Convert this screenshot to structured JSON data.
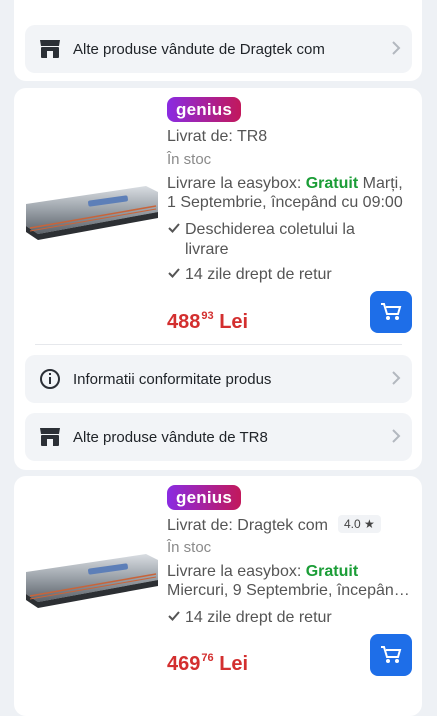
{
  "top_card": {
    "seller_row_label": "Alte produse vândute de Dragtek com"
  },
  "offers": [
    {
      "badge": "genius",
      "seller": "Livrat de: TR8",
      "rating": "",
      "stock": "În stoc",
      "delivery_prefix": "Livrare la easybox: ",
      "delivery_free": "Gratuit",
      "delivery_line1_rest": " Marți,",
      "delivery_line2": "1 Septembrie, începând cu 09:00",
      "benefits": [
        "Deschiderea coletului la",
        "livrare",
        "14 zile drept de retur"
      ],
      "price_int": "488",
      "price_dec": "93",
      "price_currency": "Lei",
      "compliance_label": "Informatii conformitate produs",
      "seller_row_label": "Alte produse vândute de TR8"
    },
    {
      "badge": "genius",
      "seller": "Livrat de: Dragtek com",
      "rating": "4.0 ★",
      "stock": "În stoc",
      "delivery_prefix": "Livrare la easybox: ",
      "delivery_free": "Gratuit",
      "delivery_line2": "Miercuri, 9 Septembrie, începân…",
      "benefits": [
        "14 zile drept de retur"
      ],
      "price_int": "469",
      "price_dec": "76",
      "price_currency": "Lei"
    }
  ],
  "icons": {
    "shop": "shop-icon",
    "info": "info-icon",
    "chevron": "chevron-right-icon",
    "check": "check-icon",
    "cart": "cart-icon"
  },
  "colors": {
    "price": "#d32f2f",
    "free": "#1b9d37",
    "cart_button": "#1e6ee8",
    "background": "#eef1f5"
  }
}
